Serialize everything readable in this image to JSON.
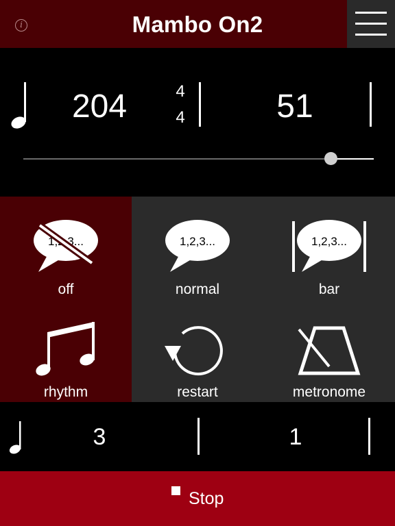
{
  "header": {
    "title": "Mambo On2",
    "info_glyph": "i",
    "info_icon": "info-icon",
    "menu_icon": "hamburger-menu-icon",
    "background": "#4a0004"
  },
  "tempo": {
    "bpm": "204",
    "time_signature_top": "4",
    "time_signature_bottom": "4",
    "bar_count": "51",
    "slider_fraction": 0.82
  },
  "modes": {
    "selected": "off",
    "items": [
      {
        "label": "off",
        "icon": "speech-bubble-crossed-icon",
        "bubble_text": "1,2,3..."
      },
      {
        "label": "normal",
        "icon": "speech-bubble-icon",
        "bubble_text": "1,2,3..."
      },
      {
        "label": "bar",
        "icon": "speech-bubble-bars-icon",
        "bubble_text": "1,2,3..."
      },
      {
        "label": "rhythm",
        "icon": "music-notes-icon"
      },
      {
        "label": "restart",
        "icon": "restart-arrow-icon"
      },
      {
        "label": "metronome",
        "icon": "metronome-icon"
      }
    ]
  },
  "beat": {
    "current_beat": "3",
    "current_bar": "1"
  },
  "stop": {
    "label": "Stop",
    "background": "#9e0012"
  }
}
